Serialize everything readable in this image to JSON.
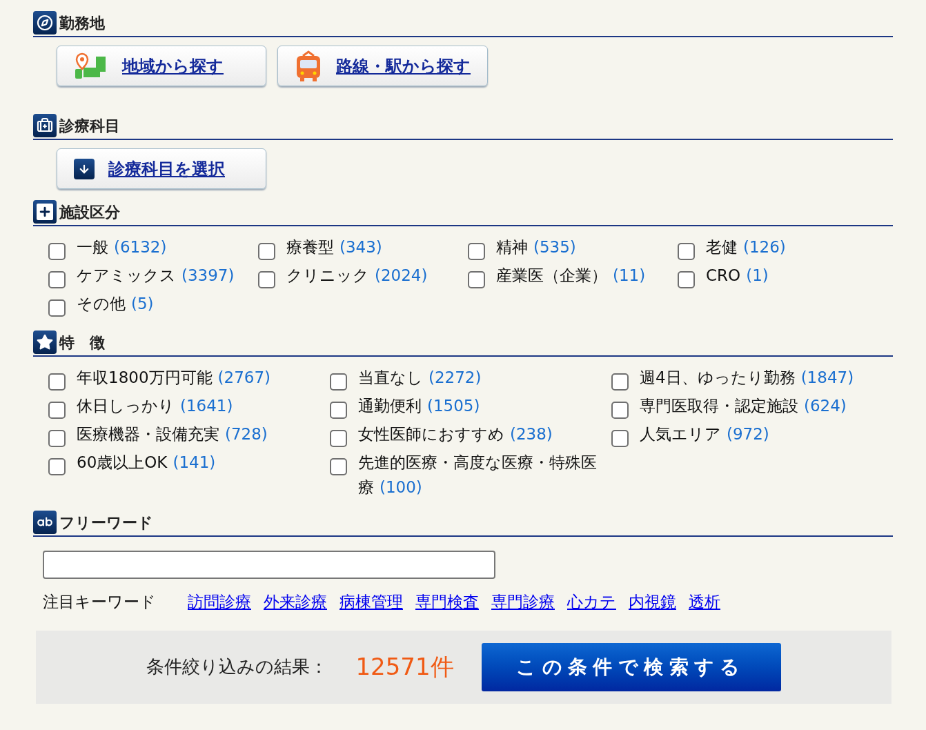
{
  "sections": [
    {
      "kind": "buttons",
      "title": "勤務地",
      "buttons": [
        {
          "label": "地域から探す"
        },
        {
          "label": "路線・駅から探す"
        }
      ]
    },
    {
      "kind": "buttons",
      "title": "診療科目",
      "buttons": [
        {
          "label": "診療科目を選択"
        }
      ]
    },
    {
      "kind": "facility",
      "title": "施設区分",
      "options": [
        {
          "label": "一般",
          "count": "(6132)",
          "checked": false
        },
        {
          "label": "療養型",
          "count": "(343)",
          "checked": false
        },
        {
          "label": "精神",
          "count": "(535)",
          "checked": false
        },
        {
          "label": "老健",
          "count": "(126)",
          "checked": false
        },
        {
          "label": "ケアミックス",
          "count": "(3397)",
          "checked": false
        },
        {
          "label": "クリニック",
          "count": "(2024)",
          "checked": false
        },
        {
          "label": "産業医（企業）",
          "count": "(11)",
          "checked": false
        },
        {
          "label": "CRO",
          "count": "(1)",
          "checked": false
        },
        {
          "label": "その他",
          "count": "(5)",
          "checked": false
        }
      ]
    },
    {
      "kind": "features",
      "title": "特　徴",
      "options": [
        {
          "label": "年収1800万円可能",
          "count": "(2767)",
          "checked": false
        },
        {
          "label": "当直なし",
          "count": "(2272)",
          "checked": false
        },
        {
          "label": "週4日、ゆったり勤務",
          "count": "(1847)",
          "checked": false
        },
        {
          "label": "休日しっかり",
          "count": "(1641)",
          "checked": false
        },
        {
          "label": "通勤便利",
          "count": "(1505)",
          "checked": false
        },
        {
          "label": "専門医取得・認定施設",
          "count": "(624)",
          "checked": false
        },
        {
          "label": "医療機器・設備充実",
          "count": "(728)",
          "checked": false
        },
        {
          "label": "女性医師におすすめ",
          "count": "(238)",
          "checked": false
        },
        {
          "label": "人気エリア",
          "count": "(972)",
          "checked": false
        },
        {
          "label": "60歳以上OK",
          "count": "(141)",
          "checked": false
        },
        {
          "label": "先進的医療・高度な医療・特殊医療",
          "count": "(100)",
          "checked": false
        }
      ]
    },
    {
      "kind": "freeword",
      "title": "フリーワード",
      "keywords_label": "注目キーワード",
      "keywords": [
        "訪問診療",
        "外来診療",
        "病棟管理",
        "専門検査",
        "専門診療",
        "心カテ",
        "内視鏡",
        "透析"
      ]
    }
  ],
  "result": {
    "label": "条件絞り込みの結果：",
    "count": "12571件",
    "button": "この条件で検索する"
  }
}
